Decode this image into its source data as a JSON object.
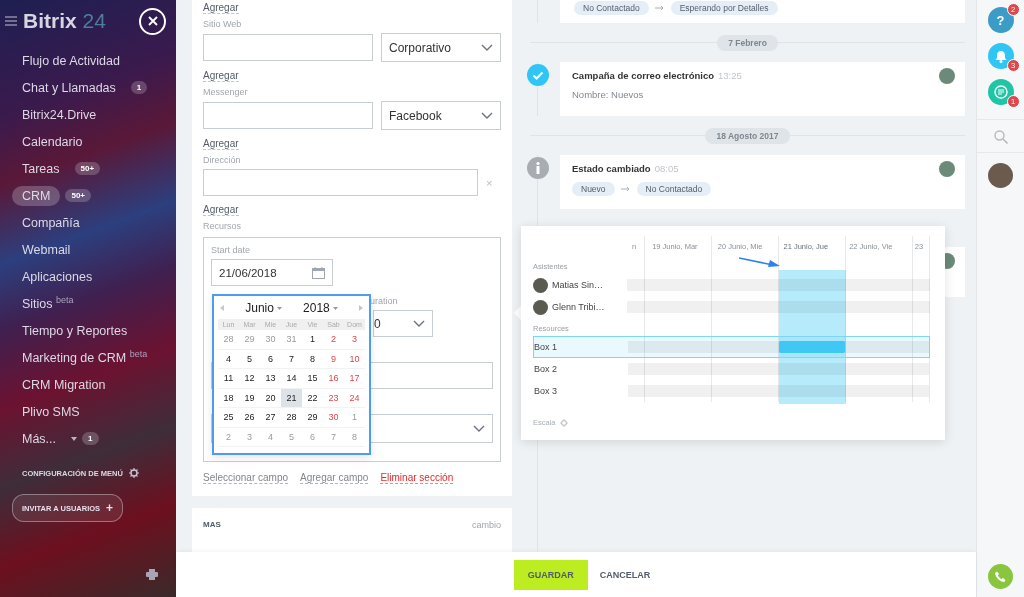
{
  "sidebar": {
    "logo_name": "Bitrix",
    "logo_number": "24",
    "items": [
      {
        "label": "Flujo de Actividad",
        "selected": false
      },
      {
        "label": "Chat y Llamadas",
        "badge": "1",
        "selected": false
      },
      {
        "label": "Bitrix24.Drive",
        "selected": false
      },
      {
        "label": "Calendario",
        "selected": false
      },
      {
        "label": "Tareas",
        "badge": "50+",
        "selected": false
      },
      {
        "label": "CRM",
        "badge": "50+",
        "selected": true
      },
      {
        "label": "Compañía",
        "selected": false
      },
      {
        "label": "Webmail",
        "selected": false
      },
      {
        "label": "Aplicaciones",
        "selected": false
      },
      {
        "label": "Sitios $^{beta}$",
        "selected": false
      },
      {
        "label": "Tiempo y Reportes",
        "selected": false
      },
      {
        "label": "Marketing de CRM $^{beta}$",
        "selected": false
      },
      {
        "label": "CRM Migration",
        "selected": false
      },
      {
        "label": "Plivo SMS",
        "selected": false
      },
      {
        "label": "Más...",
        "dropdown": true,
        "badge": "1",
        "selected": false
      }
    ],
    "settings_label": "CONFIGURACIÓN DE MENÚ",
    "invite_button": "INVITAR A USUARIOS",
    "invite_icon": "+"
  },
  "form": {
    "top_link": "Agregar",
    "groups": [
      {
        "kind": "select",
        "label": "Sitio Web",
        "option": "Corporativo",
        "link": "Agregar"
      },
      {
        "kind": "select",
        "label": "Messenger",
        "option": "Facebook",
        "link": "Agregar"
      },
      {
        "kind": "clear",
        "label": "Dirección",
        "clear": "×",
        "link": "Agregar"
      }
    ],
    "resources": {
      "label": "Recursos",
      "start_label": "Start date",
      "start_value": "21/06/2018",
      "duration_label": "uration",
      "duration_value": "0"
    },
    "actions": [
      {
        "kind": "normal",
        "label": "Seleccionar campo"
      },
      {
        "kind": "normal",
        "label": "Agregar campo"
      },
      {
        "kind": "danger",
        "label": "Eliminar sección"
      }
    ]
  },
  "more_section": {
    "title": "MAS",
    "action": "cambio"
  },
  "calendar": {
    "month": "Junio",
    "year": "2018",
    "weekdays": [
      "Lun",
      "Mar",
      "Mie",
      "Jue",
      "Vie",
      "Sab",
      "Dom"
    ],
    "weeks": [
      [
        {
          "day": "28",
          "kind": "other",
          "selected": false
        },
        {
          "day": "29",
          "kind": "other",
          "selected": false
        },
        {
          "day": "30",
          "kind": "other",
          "selected": false
        },
        {
          "day": "31",
          "kind": "other",
          "selected": false
        },
        {
          "day": "1",
          "kind": "weekday",
          "selected": false
        },
        {
          "day": "2",
          "kind": "weekend",
          "selected": false
        },
        {
          "day": "3",
          "kind": "weekend",
          "selected": false
        }
      ],
      [
        {
          "day": "4",
          "kind": "weekday",
          "selected": false
        },
        {
          "day": "5",
          "kind": "weekday",
          "selected": false
        },
        {
          "day": "6",
          "kind": "weekday",
          "selected": false
        },
        {
          "day": "7",
          "kind": "weekday",
          "selected": false
        },
        {
          "day": "8",
          "kind": "weekday",
          "selected": false
        },
        {
          "day": "9",
          "kind": "weekend",
          "selected": false
        },
        {
          "day": "10",
          "kind": "weekend",
          "selected": false
        }
      ],
      [
        {
          "day": "11",
          "kind": "weekday",
          "selected": false
        },
        {
          "day": "12",
          "kind": "weekday",
          "selected": false
        },
        {
          "day": "13",
          "kind": "weekday",
          "selected": false
        },
        {
          "day": "14",
          "kind": "weekday",
          "selected": false
        },
        {
          "day": "15",
          "kind": "weekday",
          "selected": false
        },
        {
          "day": "16",
          "kind": "weekend",
          "selected": false
        },
        {
          "day": "17",
          "kind": "weekend",
          "selected": false
        }
      ],
      [
        {
          "day": "18",
          "kind": "weekday",
          "selected": false
        },
        {
          "day": "19",
          "kind": "weekday",
          "selected": false
        },
        {
          "day": "20",
          "kind": "weekday",
          "selected": false
        },
        {
          "day": "21",
          "kind": "weekday",
          "selected": true
        },
        {
          "day": "22",
          "kind": "weekday",
          "selected": false
        },
        {
          "day": "23",
          "kind": "weekend",
          "selected": false
        },
        {
          "day": "24",
          "kind": "weekend",
          "selected": false
        }
      ],
      [
        {
          "day": "25",
          "kind": "weekday",
          "selected": false
        },
        {
          "day": "26",
          "kind": "weekday",
          "selected": false
        },
        {
          "day": "27",
          "kind": "weekday",
          "selected": false
        },
        {
          "day": "28",
          "kind": "weekday",
          "selected": false
        },
        {
          "day": "29",
          "kind": "weekday",
          "selected": false
        },
        {
          "day": "30",
          "kind": "weekend",
          "selected": false
        },
        {
          "day": "1",
          "kind": "other",
          "selected": false
        }
      ],
      [
        {
          "day": "2",
          "kind": "other",
          "selected": false
        },
        {
          "day": "3",
          "kind": "other",
          "selected": false
        },
        {
          "day": "4",
          "kind": "other",
          "selected": false
        },
        {
          "day": "5",
          "kind": "other",
          "selected": false
        },
        {
          "day": "6",
          "kind": "other",
          "selected": false
        },
        {
          "day": "7",
          "kind": "other",
          "selected": false
        },
        {
          "day": "8",
          "kind": "other",
          "selected": false
        }
      ]
    ]
  },
  "timeline": [
    {
      "kind": "tags",
      "tags": [
        "No Contactado",
        "Esperando por Detalles"
      ]
    },
    {
      "kind": "date",
      "label": "7 Febrero"
    },
    {
      "kind": "activity",
      "title": "Campaña de correo electrónico",
      "time": "13:25",
      "text": "Nombre: Nuevos"
    },
    {
      "kind": "date",
      "label": "18 Agosto 2017"
    },
    {
      "kind": "status",
      "title": "Estado cambiado",
      "time": "08:05",
      "tags": [
        "Nuevo",
        "No Contactado"
      ]
    },
    {
      "kind": "covered"
    }
  ],
  "scheduler": {
    "columns": [
      {
        "label": "n",
        "selected": false
      },
      {
        "label": "19 Junio, Mar",
        "selected": false
      },
      {
        "label": "20 Junio, Mie",
        "selected": false
      },
      {
        "label": "21 Junio, Jue",
        "selected": true
      },
      {
        "label": "22 Junio, Vie",
        "selected": false
      },
      {
        "label": "23",
        "selected": false
      }
    ],
    "attendees_label": "Asistentes",
    "attendees": [
      {
        "name": "Matias Sin…"
      },
      {
        "name": "Glenn Tribi…"
      }
    ],
    "resources_label": "Resources",
    "resources": [
      {
        "name": "Box 1",
        "selected": true,
        "booked": true
      },
      {
        "name": "Box 2",
        "selected": false,
        "booked": false
      },
      {
        "name": "Box 3",
        "selected": false,
        "booked": false
      }
    ],
    "scale_label": "Escala"
  },
  "rail": {
    "buttons": [
      {
        "kind": "help",
        "glyph": "?",
        "badge": "2"
      },
      {
        "kind": "bell",
        "badge": "3"
      },
      {
        "kind": "chat",
        "badge": "1"
      }
    ]
  },
  "footer": {
    "save": "GUARDAR",
    "cancel": "CANCELAR"
  }
}
